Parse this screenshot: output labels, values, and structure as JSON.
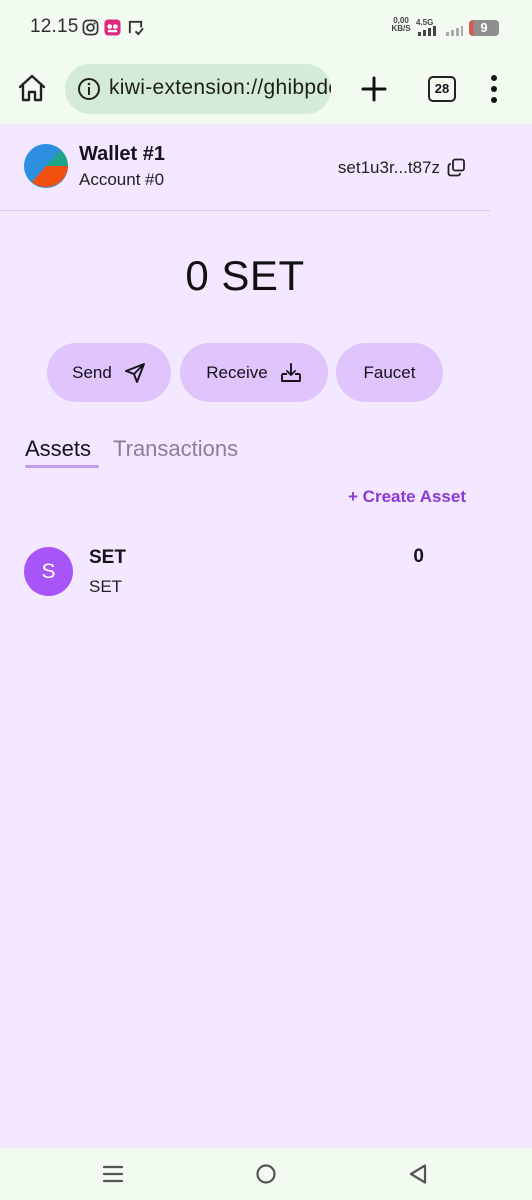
{
  "status_bar": {
    "time": "12.15",
    "net_speed_value": "0,00",
    "net_speed_unit": "KB/S",
    "network_type": "4.5G",
    "battery_level": "9"
  },
  "browser": {
    "url": "kiwi-extension://ghibpddmemnnbdbejmhcfgjckepkgdec/popup.html",
    "tab_count": "28"
  },
  "wallet": {
    "name": "Wallet #1",
    "account": "Account #0",
    "address": "set1u3r...t87z"
  },
  "balance": "0 SET",
  "actions": {
    "send": "Send",
    "receive": "Receive",
    "faucet": "Faucet"
  },
  "tabs": {
    "assets": "Assets",
    "transactions": "Transactions"
  },
  "create_asset": "+ Create Asset",
  "assets": [
    {
      "avatar_letter": "S",
      "name": "SET",
      "symbol": "SET",
      "amount": "0"
    }
  ],
  "colors": {
    "page_background": "#f3e8ff",
    "button_background": "#dfc5fb",
    "accent": "#8d38d8",
    "asset_avatar": "#a855f7",
    "chrome_background": "#f2fbf0",
    "url_pill": "#d4ecd7"
  },
  "icons": {
    "home": "home-icon",
    "info": "info-icon",
    "plus": "plus-icon",
    "menu": "more-vertical-icon",
    "copy": "copy-icon",
    "send": "paper-plane-icon",
    "receive": "download-tray-icon",
    "nav_recents": "recents-icon",
    "nav_home": "home-circle-icon",
    "nav_back": "back-triangle-icon"
  }
}
